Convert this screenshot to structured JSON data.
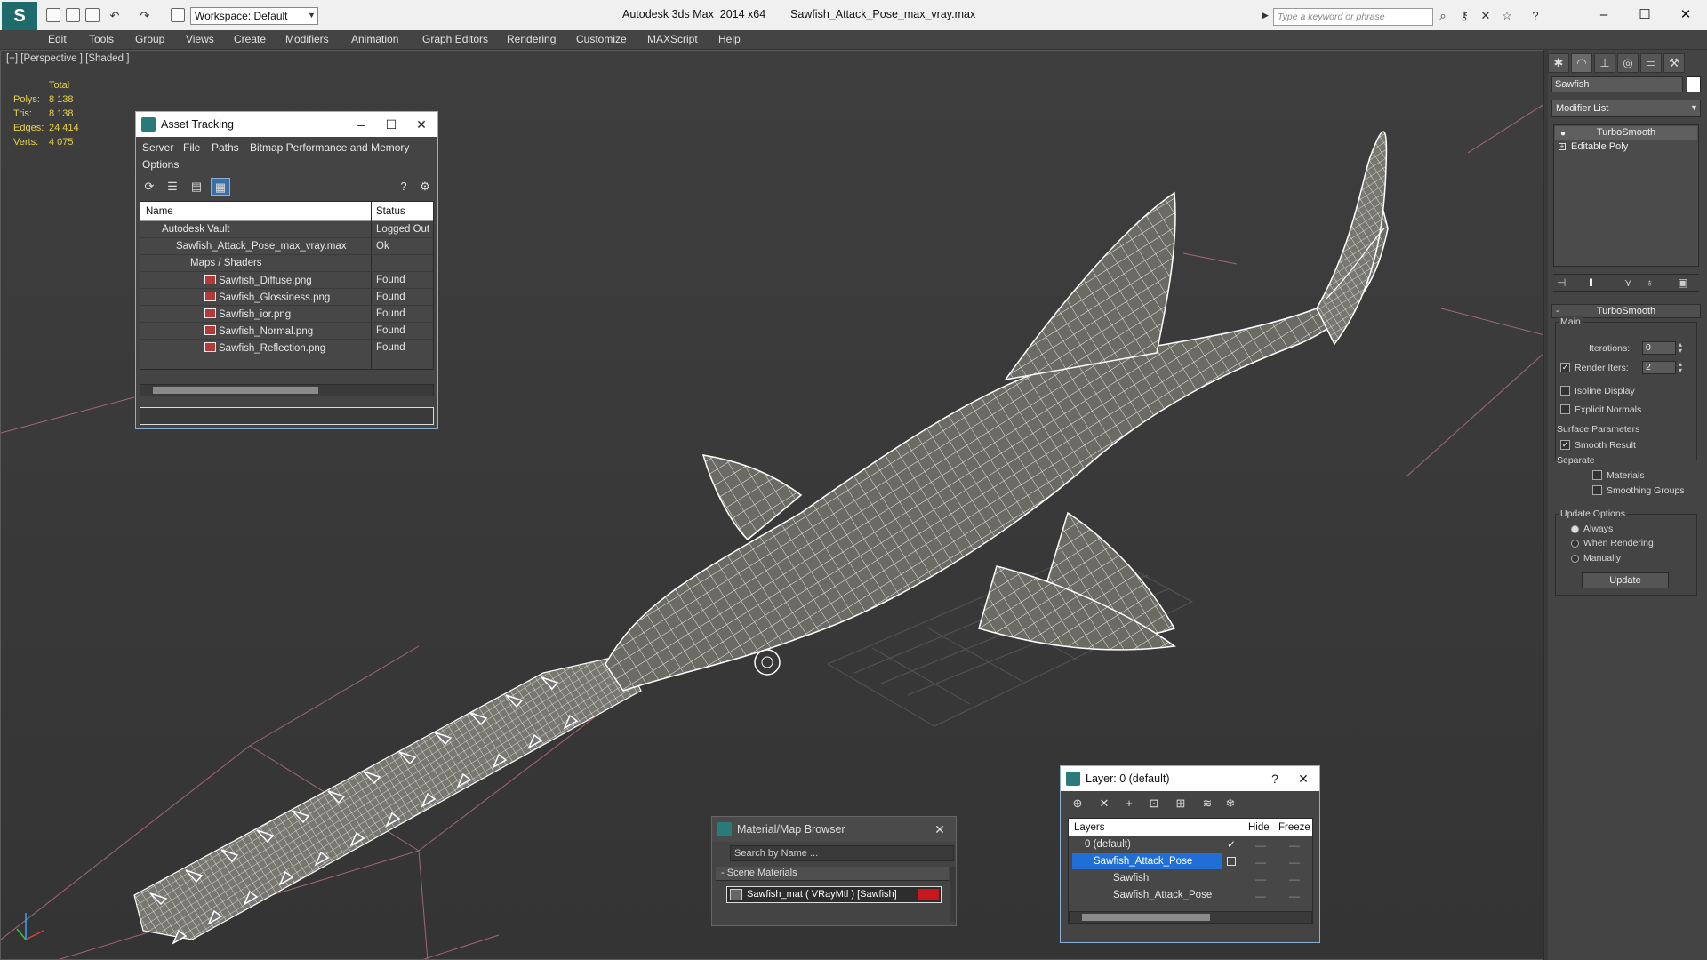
{
  "titlebar": {
    "app_logo": "S",
    "workspace": "Workspace: Default",
    "app_name": "Autodesk 3ds Max  2014 x64",
    "file_name": "Sawfish_Attack_Pose_max_vray.max",
    "search_placeholder": "Type a keyword or phrase"
  },
  "menu": [
    "Edit",
    "Tools",
    "Group",
    "Views",
    "Create",
    "Modifiers",
    "Animation",
    "Graph Editors",
    "Rendering",
    "Customize",
    "MAXScript",
    "Help"
  ],
  "viewport": {
    "label": "[+] [Perspective ] [Shaded ]",
    "stats": {
      "header": "Total",
      "rows": [
        {
          "label": "Polys:",
          "value": "8 138"
        },
        {
          "label": "Tris:",
          "value": "8 138"
        },
        {
          "label": "Edges:",
          "value": "24 414"
        },
        {
          "label": "Verts:",
          "value": "4 075"
        }
      ]
    }
  },
  "asset_tracking": {
    "title": "Asset Tracking",
    "menu": [
      "Server",
      "File",
      "Paths",
      "Bitmap Performance and Memory",
      "Options"
    ],
    "columns": [
      "Name",
      "Status"
    ],
    "rows": [
      {
        "name": "Autodesk Vault",
        "status": "Logged Out",
        "indent": 0
      },
      {
        "name": "Sawfish_Attack_Pose_max_vray.max",
        "status": "Ok",
        "indent": 1
      },
      {
        "name": "Maps / Shaders",
        "status": "",
        "indent": 2
      },
      {
        "name": "Sawfish_Diffuse.png",
        "status": "Found",
        "indent": 3
      },
      {
        "name": "Sawfish_Glossiness.png",
        "status": "Found",
        "indent": 3
      },
      {
        "name": "Sawfish_ior.png",
        "status": "Found",
        "indent": 3
      },
      {
        "name": "Sawfish_Normal.png",
        "status": "Found",
        "indent": 3
      },
      {
        "name": "Sawfish_Reflection.png",
        "status": "Found",
        "indent": 3
      }
    ],
    "scroll_fraction": 0.62
  },
  "material_browser": {
    "title": "Material/Map Browser",
    "search_placeholder": "Search by Name ...",
    "section": "Scene Materials",
    "item": "Sawfish_mat  ( VRayMtl )  [Sawfish]"
  },
  "layer_dialog": {
    "title": "Layer: 0 (default)",
    "columns": [
      "Layers",
      "Hide",
      "Freeze"
    ],
    "rows": [
      {
        "name": "0 (default)",
        "indent": 0,
        "selected": false
      },
      {
        "name": "Sawfish_Attack_Pose",
        "indent": 0,
        "selected": true
      },
      {
        "name": "Sawfish",
        "indent": 1,
        "selected": false
      },
      {
        "name": "Sawfish_Attack_Pose",
        "indent": 1,
        "selected": false
      }
    ],
    "scroll_fraction": 0.6
  },
  "command_panel": {
    "object_name": "Sawfish",
    "modifier_list": "Modifier List",
    "stack": [
      "TurboSmooth",
      "Editable Poly"
    ],
    "turbosmooth": {
      "title": "TurboSmooth",
      "main": "Main",
      "iterations_label": "Iterations:",
      "iterations": "0",
      "render_iters_label": "Render Iters:",
      "render_iters": "2",
      "isoline": "Isoline Display",
      "explicit": "Explicit Normals",
      "surface": "Surface Parameters",
      "smooth_result": "Smooth Result",
      "separate": "Separate",
      "materials": "Materials",
      "smoothing_groups": "Smoothing Groups",
      "update_options": "Update Options",
      "always": "Always",
      "when_rendering": "When Rendering",
      "manually": "Manually",
      "update": "Update"
    }
  },
  "colors": {
    "accent": "#3a8ee6",
    "selection": "#1f6fd6",
    "stats": "#e8d24a",
    "mesh_wire": "#f2f2f2",
    "mesh_fill": "#6b6b64",
    "red_material": "#c8181e"
  }
}
